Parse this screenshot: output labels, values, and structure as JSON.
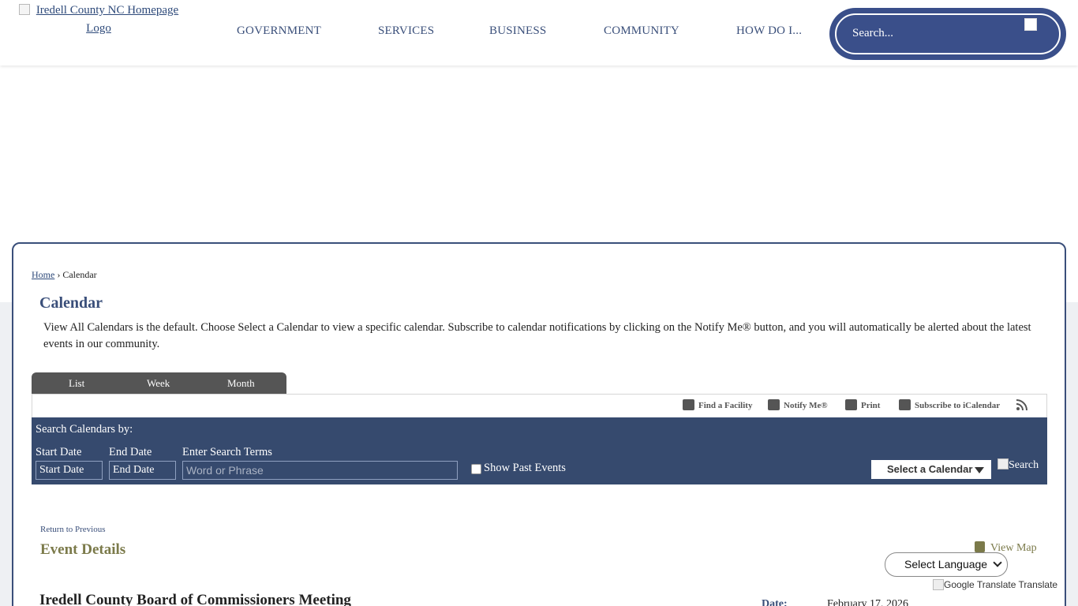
{
  "header": {
    "logo_alt": "Iredell County NC Homepage Logo",
    "nav": [
      "GOVERNMENT",
      "SERVICES",
      "BUSINESS",
      "COMMUNITY",
      "HOW DO I..."
    ],
    "search_placeholder": "Search..."
  },
  "breadcrumb": {
    "home": "Home",
    "separator": "›",
    "current": "Calendar"
  },
  "page": {
    "title": "Calendar",
    "description": "View All Calendars is the default. Choose Select a Calendar to view a specific calendar. Subscribe to calendar notifications by clicking on the Notify Me® button, and you will automatically be alerted about the latest events in our community."
  },
  "tabs": [
    "List",
    "Week",
    "Month"
  ],
  "toolbar": {
    "find_facility": "Find a Facility",
    "notify_me": "Notify Me®",
    "print": "Print",
    "subscribe": "Subscribe to iCalendar"
  },
  "filter": {
    "heading": "Search Calendars by:",
    "start_label": "Start Date",
    "start_value": "Start Date",
    "end_label": "End Date",
    "end_value": "End Date",
    "terms_label": "Enter Search Terms",
    "terms_placeholder": "Word or Phrase",
    "past_events": "Show Past Events",
    "select_calendar": "Select a Calendar",
    "search_alt": "Search"
  },
  "event": {
    "return": "Return to Previous",
    "heading": "Event Details",
    "view_map": "View Map",
    "title": "Iredell County Board of Commissioners Meeting",
    "date_label": "Date:",
    "date_value": "February 17, 2026"
  },
  "translate": {
    "select_language": "Select Language",
    "powered": "Google Translate",
    "translate_label": "Translate"
  },
  "colors": {
    "navy": "#364a6e",
    "accent": "#3a4f7a",
    "olive": "#7b7a4a"
  }
}
